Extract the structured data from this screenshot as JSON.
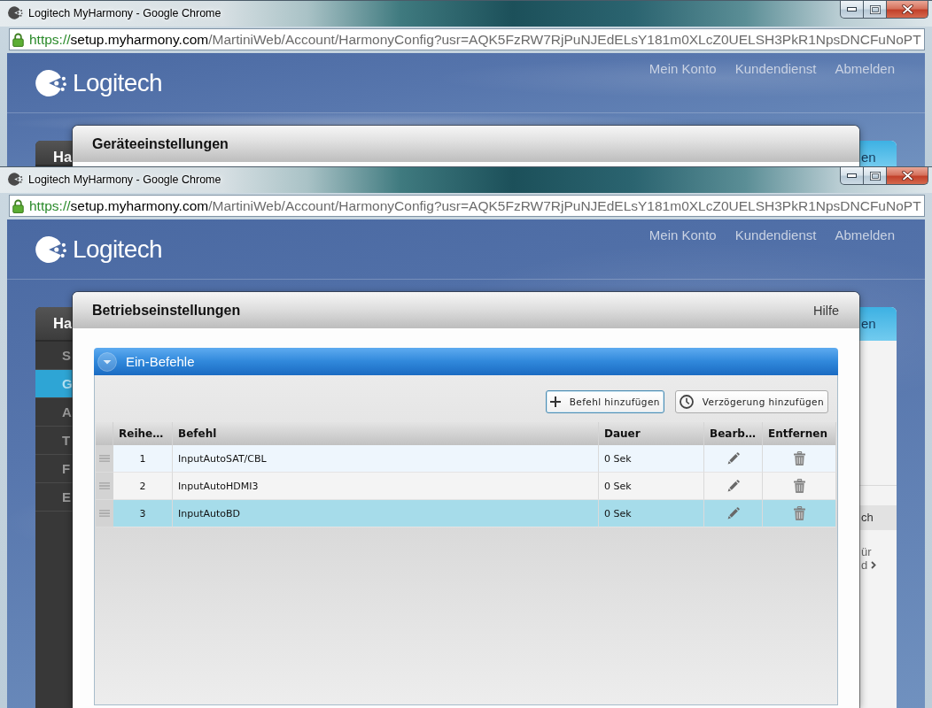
{
  "windows": [
    {
      "title": "Logitech MyHarmony - Google Chrome",
      "address": {
        "scheme": "https://",
        "host": "setup.myharmony.com",
        "path": "/MartiniWeb/Account/HarmonyConfig?usr=AQK5FzRW7RjPuNJEdELsY181m0XLcZ0UELSH3PkR1NpsDNCFuNoPT"
      },
      "page": {
        "brand": "Logitech",
        "nav": [
          "Mein Konto",
          "Kundendienst",
          "Abmelden"
        ],
        "sidebar": {
          "title": "Ha"
        },
        "side_panel": {
          "tab": "en"
        },
        "dialog": {
          "title": "Geräteeinstellungen"
        }
      }
    },
    {
      "title": "Logitech MyHarmony - Google Chrome",
      "address": {
        "scheme": "https://",
        "host": "setup.myharmony.com",
        "path": "/MartiniWeb/Account/HarmonyConfig?usr=AQK5FzRW7RjPuNJEdELsY181m0XLcZ0UELSH3PkR1NpsDNCFuNoPT"
      },
      "page": {
        "brand": "Logitech",
        "nav": [
          "Mein Konto",
          "Kundendienst",
          "Abmelden"
        ],
        "sidebar": {
          "title": "Ha",
          "items": [
            {
              "label": "S",
              "selected": false
            },
            {
              "label": "G",
              "selected": true
            },
            {
              "label": "A",
              "selected": false
            },
            {
              "label": "T",
              "selected": false
            },
            {
              "label": "F",
              "selected": false
            },
            {
              "label": "E",
              "selected": false
            }
          ]
        },
        "side_panel": {
          "tab": "en",
          "section_title": "ch",
          "link_lines": [
            "ür",
            "d"
          ]
        },
        "dialog": {
          "title": "Betriebseinstellungen",
          "help": "Hilfe",
          "accordion": {
            "title": "Ein-Befehle",
            "expanded": true,
            "buttons": [
              {
                "kind": "add",
                "label": "Befehl hinzufügen",
                "focused": true
              },
              {
                "kind": "delay",
                "label": "Verzögerung hinzufügen",
                "focused": false
              }
            ],
            "table": {
              "columns": [
                "Reihe…",
                "Befehl",
                "Dauer",
                "Bearb…",
                "Entfernen"
              ],
              "rows": [
                {
                  "order": "1",
                  "command": "InputAutoSAT/CBL",
                  "duration": "0 Sek",
                  "selected": false
                },
                {
                  "order": "2",
                  "command": "InputAutoHDMI3",
                  "duration": "0 Sek",
                  "selected": false
                },
                {
                  "order": "3",
                  "command": "InputAutoBD",
                  "duration": "0 Sek",
                  "selected": true
                }
              ]
            }
          }
        }
      }
    }
  ]
}
